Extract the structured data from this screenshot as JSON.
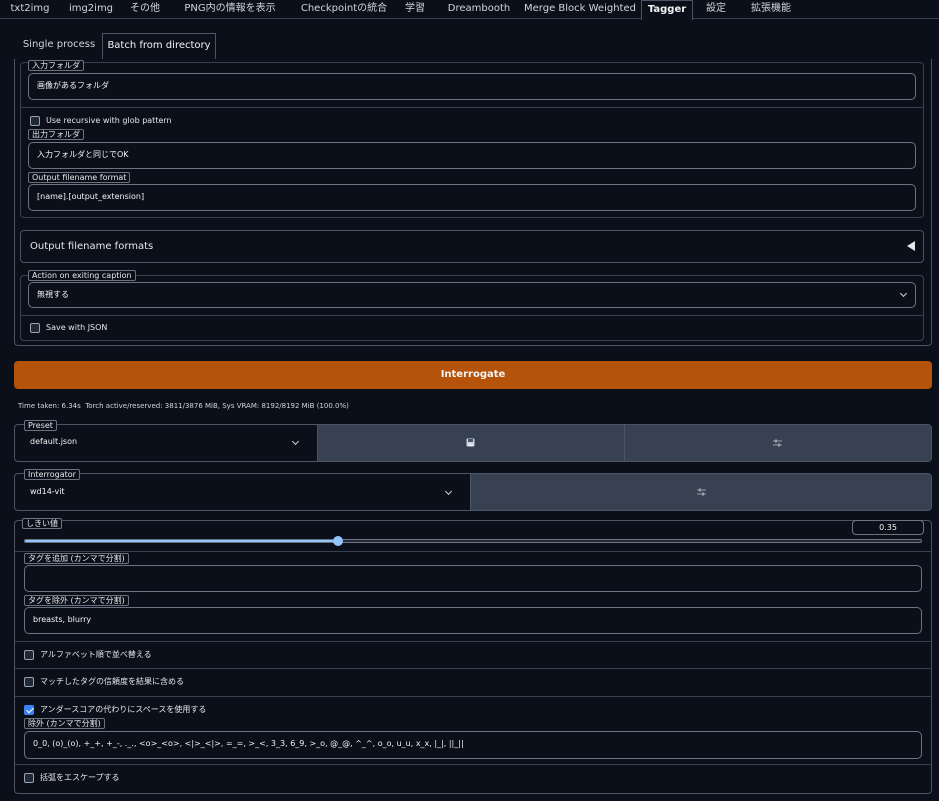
{
  "top_tabs": [
    "txt2img",
    "img2img",
    "その他",
    "PNG内の情報を表示",
    "Checkpointの統合",
    "学習",
    "Dreambooth",
    "Merge Block Weighted",
    "Tagger",
    "設定",
    "拡張機能"
  ],
  "active_top_tab": "Tagger",
  "sub_tabs": [
    "Single process",
    "Batch from directory"
  ],
  "active_sub_tab": "Batch from directory",
  "batch": {
    "input_label": "入力フォルダ",
    "input_value": "画像があるフォルダ",
    "recursive_label": "Use recursive with glob pattern",
    "recursive_checked": false,
    "output_label": "出力フォルダ",
    "output_value": "入力フォルダと同じでOK",
    "filename_format_label": "Output filename format",
    "filename_format_value": "[name].[output_extension]",
    "formats_accordion": "Output filename formats",
    "caption_action_label": "Action on exiting caption",
    "caption_action_value": "無視する",
    "save_json_label": "Save with JSON",
    "save_json_checked": false
  },
  "interrogate_button": "Interrogate",
  "interrogate_color": "#b45309",
  "status_text": "Time taken: 6.34s  Torch active/reserved: 3811/3876 MiB, Sys VRAM: 8192/8192 MiB (100.0%)",
  "preset": {
    "label": "Preset",
    "value": "default.json",
    "save_icon": "save-icon",
    "settings_icon": "sliders-icon"
  },
  "interrogator": {
    "label": "Interrogator",
    "value": "wd14-vit",
    "settings_icon": "sliders-icon"
  },
  "threshold": {
    "label": "しきい値",
    "value": "0.35",
    "fraction": 0.35
  },
  "add_tags": {
    "label": "タグを追加 (カンマで分割)",
    "value": ""
  },
  "exclude_tags": {
    "label": "タグを除外 (カンマで分割)",
    "value": "breasts, blurry"
  },
  "options": {
    "sort_alpha": {
      "label": "アルファベット順で並べ替える",
      "checked": false
    },
    "include_confidence": {
      "label": "マッチしたタグの信頼度を結果に含める",
      "checked": false
    },
    "use_spaces": {
      "label": "アンダースコアの代わりにスペースを使用する",
      "checked": true
    },
    "exclude_label": "除外 (カンマで分割)",
    "exclude_value": "0_0, (o)_(o), +_+, +_-, ._., <o>_<o>, <|>_<|>, =_=, >_<, 3_3, 6_9, >_o, @_@, ^_^, o_o, u_u, x_x, |_|, ||_||",
    "escape_brackets": {
      "label": "括弧をエスケープする",
      "checked": false
    }
  },
  "colors": {
    "background": "#0b0f19",
    "slider_fill": "#93c5fd",
    "checkbox_checked": "#3b82f6"
  }
}
